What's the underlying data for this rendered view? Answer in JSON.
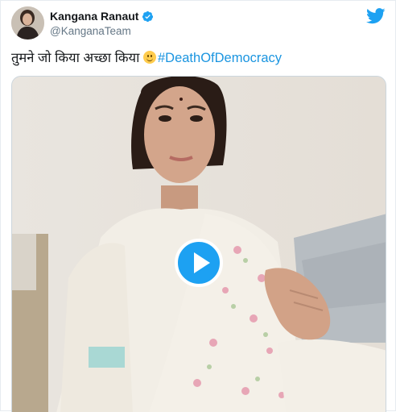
{
  "tweet": {
    "author_name": "Kangana Ranaut",
    "author_handle": "@KanganaTeam",
    "text": "तुमने जो किया अच्छा किया",
    "emoji": "slightly-smiling-face",
    "hashtag": "#DeathOfDemocracy",
    "verified": true
  },
  "media": {
    "type": "video",
    "play_icon": "play-icon"
  },
  "colors": {
    "accent": "#1da1f2",
    "hashtag": "#1b95e0",
    "handle": "#657786",
    "text": "#14171a"
  }
}
